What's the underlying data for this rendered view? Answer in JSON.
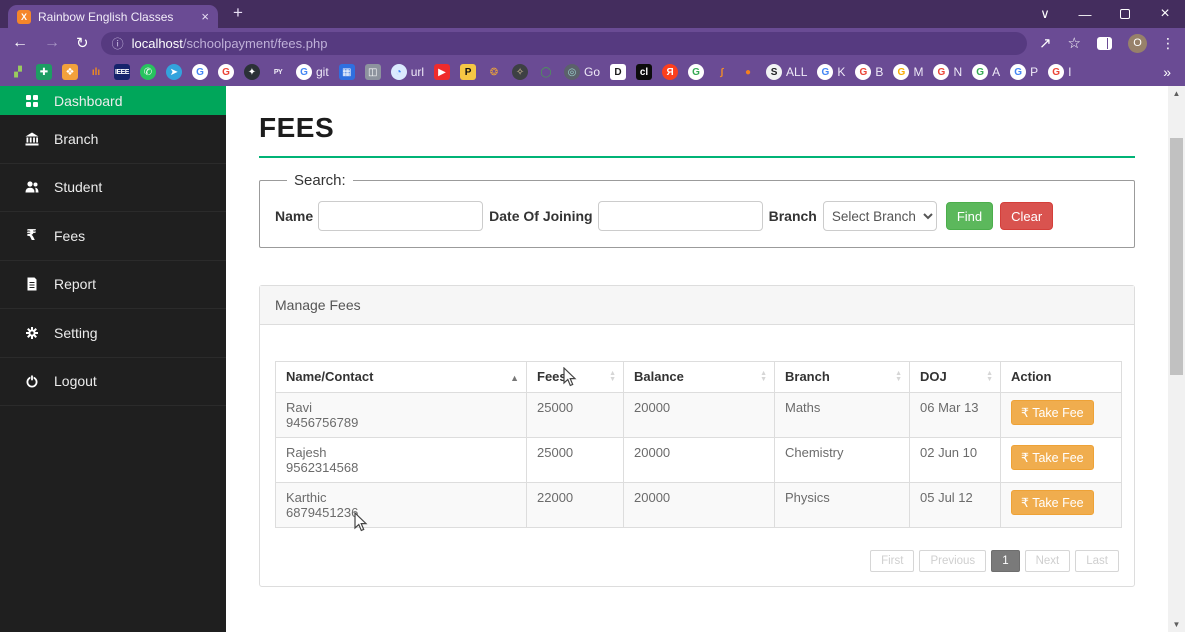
{
  "browser": {
    "tab_title": "Rainbow English Classes",
    "favicon_letter": "X",
    "url_host": "localhost",
    "url_path": "/schoolpayment/fees.php",
    "avatar_letter": "O",
    "glyphs": {
      "tab_close": "×",
      "newtab": "+",
      "chevron": "∨",
      "minimize": "—",
      "close": "×",
      "back": "←",
      "forward": "→",
      "reload": "↻",
      "info": "ⓘ",
      "share": "↗",
      "star": "☆",
      "dots": "⋮",
      "scroll_up": "▲",
      "scroll_down": "▼",
      "sort_asc": "▲",
      "sort_up": "▲",
      "sort_down": "▼",
      "overflow": "»"
    },
    "bookmarks": [
      {
        "name": "leaf",
        "glyph": "▞",
        "bg": "",
        "fg": "#9acc5e"
      },
      {
        "name": "green-cross",
        "glyph": "✚",
        "bg": "#1d9e63",
        "fg": "#ffffff"
      },
      {
        "name": "orange-badge",
        "glyph": "❖",
        "bg": "#f2a13c",
        "fg": "#ffffff"
      },
      {
        "name": "analytics",
        "glyph": "ılı",
        "bg": "",
        "fg": "#ef8b1f"
      },
      {
        "name": "ieee",
        "glyph": "IEEE",
        "bg": "#16246c",
        "fg": "#ffffff",
        "small": true
      },
      {
        "name": "whatsapp",
        "glyph": "✆",
        "bg": "#28c35e",
        "fg": "#ffffff",
        "round": true
      },
      {
        "name": "telegram",
        "glyph": "➤",
        "bg": "#33a3dd",
        "fg": "#ffffff",
        "round": true
      },
      {
        "name": "google-blue",
        "glyph": "G",
        "bg": "#ffffff",
        "fg": "#4285f4",
        "round": true
      },
      {
        "name": "google-red",
        "glyph": "G",
        "bg": "#ffffff",
        "fg": "#ea4335",
        "round": true
      },
      {
        "name": "github",
        "glyph": "✦",
        "bg": "#2b3137",
        "fg": "#ffffff",
        "round": true
      },
      {
        "name": "py",
        "glyph": "PY",
        "bg": "",
        "fg": "#f1eef8",
        "small": true
      },
      {
        "name": "google-git",
        "glyph": "G",
        "bg": "#ffffff",
        "fg": "#4285f4",
        "round": true,
        "label": "git"
      },
      {
        "name": "blue-app",
        "glyph": "▦",
        "bg": "#2f6fe0",
        "fg": "#ffffff"
      },
      {
        "name": "gray-cam",
        "glyph": "◫",
        "bg": "#8d939e",
        "fg": "#ffffff"
      },
      {
        "name": "url",
        "glyph": "◔",
        "bg": "#dbeafe",
        "fg": "#3b82f6",
        "round": true,
        "label": "url"
      },
      {
        "name": "youtube",
        "glyph": "▶",
        "bg": "#ef2b2b",
        "fg": "#ffffff"
      },
      {
        "name": "p-yellow",
        "glyph": "P",
        "bg": "#f6c744",
        "fg": "#111111"
      },
      {
        "name": "movie",
        "glyph": "❂",
        "bg": "",
        "fg": "#e9a13c"
      },
      {
        "name": "cart",
        "glyph": "✧",
        "bg": "#3d4043",
        "fg": "#d9c49a",
        "round": true
      },
      {
        "name": "green-ring",
        "glyph": "◯",
        "bg": "",
        "fg": "#46a24f"
      },
      {
        "name": "go",
        "glyph": "◎",
        "bg": "#5b616b",
        "fg": "#9fd6d2",
        "round": true,
        "label": "Go"
      },
      {
        "name": "duck",
        "glyph": "D",
        "bg": "#ffffff",
        "fg": "#1b1b1b"
      },
      {
        "name": "cl",
        "glyph": "cl",
        "bg": "#0c0c0c",
        "fg": "#ffffff"
      },
      {
        "name": "yandex",
        "glyph": "Я",
        "bg": "#fc3f1d",
        "fg": "#ffffff",
        "round": true
      },
      {
        "name": "google-green",
        "glyph": "G",
        "bg": "#ffffff",
        "fg": "#34a853",
        "round": true
      },
      {
        "name": "swoosh",
        "glyph": "∫",
        "bg": "",
        "fg": "#f28c28"
      },
      {
        "name": "orange-dot",
        "glyph": "●",
        "bg": "",
        "fg": "#f4801f"
      },
      {
        "name": "globe-all",
        "glyph": "S",
        "bg": "#f1f3f4",
        "fg": "#202124",
        "round": true,
        "label": "ALL"
      },
      {
        "name": "g-k",
        "glyph": "G",
        "bg": "#ffffff",
        "fg": "#4285f4",
        "round": true,
        "label": "K"
      },
      {
        "name": "g-b",
        "glyph": "G",
        "bg": "#ffffff",
        "fg": "#ea4335",
        "round": true,
        "label": "B"
      },
      {
        "name": "g-m",
        "glyph": "G",
        "bg": "#ffffff",
        "fg": "#f9ab00",
        "round": true,
        "label": "M"
      },
      {
        "name": "g-n",
        "glyph": "G",
        "bg": "#ffffff",
        "fg": "#ea4335",
        "round": true,
        "label": "N"
      },
      {
        "name": "g-a",
        "glyph": "G",
        "bg": "#ffffff",
        "fg": "#34a853",
        "round": true,
        "label": "A"
      },
      {
        "name": "g-p",
        "glyph": "G",
        "bg": "#ffffff",
        "fg": "#4285f4",
        "round": true,
        "label": "P"
      },
      {
        "name": "g-i",
        "glyph": "G",
        "bg": "#ffffff",
        "fg": "#ea4335",
        "round": true,
        "label": "I"
      }
    ]
  },
  "sidebar": {
    "fees_glyph": "₹",
    "items": [
      {
        "label": "Dashboard",
        "active": true
      },
      {
        "label": "Branch"
      },
      {
        "label": "Student"
      },
      {
        "label": "Fees"
      },
      {
        "label": "Report"
      },
      {
        "label": "Setting"
      },
      {
        "label": "Logout"
      }
    ]
  },
  "page": {
    "title": "FEES",
    "search": {
      "legend": "Search:",
      "name_label": "Name",
      "doj_label": "Date Of Joining",
      "branch_label": "Branch",
      "branch_value": "Select Branch",
      "find": "Find",
      "clear": "Clear"
    },
    "panel_title": "Manage Fees",
    "table": {
      "columns": [
        "Name/Contact",
        "Fees",
        "Balance",
        "Branch",
        "DOJ",
        "Action"
      ],
      "rows": [
        {
          "name": "Ravi",
          "contact": "9456756789",
          "fees": "25000",
          "balance": "20000",
          "branch": "Maths",
          "doj": "06 Mar 13",
          "action": "₹ Take Fee"
        },
        {
          "name": "Rajesh",
          "contact": "9562314568",
          "fees": "25000",
          "balance": "20000",
          "branch": "Chemistry",
          "doj": "02 Jun 10",
          "action": "₹ Take Fee"
        },
        {
          "name": "Karthic",
          "contact": "6879451236",
          "fees": "22000",
          "balance": "20000",
          "branch": "Physics",
          "doj": "05 Jul 12",
          "action": "₹ Take Fee"
        }
      ]
    },
    "pagination": {
      "first": "First",
      "previous": "Previous",
      "page": "1",
      "next": "Next",
      "last": "Last"
    }
  },
  "colors": {
    "sidebar_active_green": "#00a65a",
    "title_underline_green": "#00b376",
    "find_button_green": "#5cb85c",
    "clear_button_red": "#d9534f",
    "take_fee_orange": "#f0ad4e",
    "chrome_titlebar": "#442d5e",
    "chrome_toolbar": "#6a4b94"
  }
}
